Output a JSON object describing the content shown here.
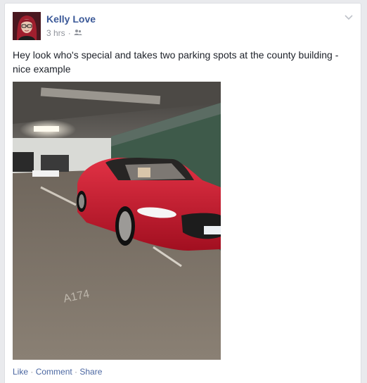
{
  "post": {
    "author": "Kelly Love",
    "timestamp": "3 hrs",
    "separator": "·",
    "audience_icon": "friends-icon",
    "text": "Hey look who's special and takes two parking spots at the county building - nice example",
    "photo_plate_text": "A174",
    "menu_icon": "chevron-down-icon"
  },
  "actions": {
    "like": "Like",
    "comment": "Comment",
    "share": "Share",
    "sep": " · "
  },
  "colors": {
    "name_link": "#3b5998",
    "action_link": "#4b67a1",
    "meta_gray": "#90949c",
    "car_red": "#c8162c"
  }
}
